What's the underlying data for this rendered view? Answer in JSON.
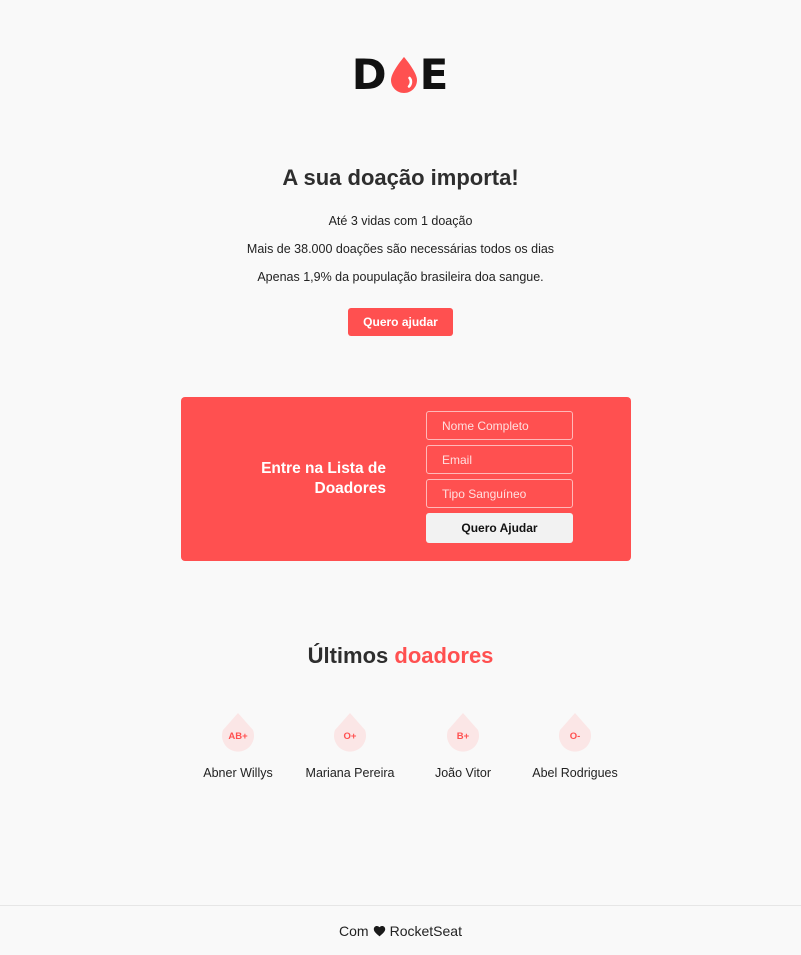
{
  "brand": {
    "letter_left": "D",
    "letter_right": "E",
    "accent_color": "#ff5050"
  },
  "hero": {
    "title": "A sua doação importa!",
    "facts": [
      "Até 3 vidas com 1 doação",
      "Mais de 38.000 doações são necessárias todos os dias",
      "Apenas 1,9% da poupulação brasileira doa sangue."
    ],
    "cta_label": "Quero ajudar"
  },
  "form": {
    "title_line1": "Entre na Lista de",
    "title_line2": "Doadores",
    "name_placeholder": "Nome Completo",
    "email_placeholder": "Email",
    "blood_placeholder": "Tipo Sanguíneo",
    "submit_label": "Quero Ajudar"
  },
  "donors_section": {
    "title_prefix": "Últimos",
    "title_accent": "doadores",
    "donors": [
      {
        "blood": "AB+",
        "name": "Abner Willys"
      },
      {
        "blood": "O+",
        "name": "Mariana Pereira"
      },
      {
        "blood": "B+",
        "name": "João Vitor"
      },
      {
        "blood": "O-",
        "name": "Abel Rodrigues"
      }
    ]
  },
  "footer": {
    "prefix": "Com",
    "icon": "heart-icon",
    "suffix": "RocketSeat"
  }
}
